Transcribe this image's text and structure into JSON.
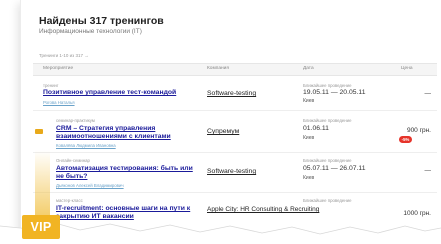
{
  "page": {
    "title": "Найдены 317 тренингов",
    "subtitle": "Информационные технологии (IT)",
    "pager": "Тренинги 1-10 из 317 →"
  },
  "table": {
    "columns": [
      "Мероприятие",
      "Компания",
      "Дата",
      "Цена"
    ],
    "rows": [
      {
        "type": "тренинг",
        "name": "Позитивное управление тест-командой",
        "author": "Рогова Наталья",
        "company": "Software-testing",
        "date_label": "Ближайшее проведение",
        "date": "19.05.11 — 20.05.11",
        "city": "Киев",
        "price": "—",
        "discount": "",
        "vip": false
      },
      {
        "type": "семинар-практикум",
        "name": "CRM – Стратегия управления взаимоотношениями с клиентами",
        "author": "Ковалёва Людмила Ивановна",
        "company": "Супремум",
        "date_label": "Ближайшее проведение",
        "date": "01.06.11",
        "city": "Киев",
        "price": "900 грн.",
        "discount": "-5%",
        "vip": true
      },
      {
        "type": "Онлайн-семинар",
        "name": "Автоматизация тестирования: быть или не быть?",
        "author": "Дьяконов Алексей Владимирович",
        "company": "Software-testing",
        "date_label": "Ближайшее проведение",
        "date": "05.07.11 — 26.07.11",
        "city": "Киев",
        "price": "—",
        "discount": "",
        "vip": false
      },
      {
        "type": "мастер-класс",
        "name": "IT-recruitment: основные шаги на пути к закрытию ИТ вакансии",
        "author": "",
        "company": "Apple City: HR Consulting & Recruiting",
        "date_label": "Ближайшее проведение",
        "date": "",
        "city": "",
        "price": "1000 грн.",
        "discount": "",
        "vip": false
      }
    ]
  },
  "vip_badge": "VIP",
  "colors": {
    "link": "#1a1a9a",
    "vip": "#f1b423",
    "discount": "#e6332a"
  }
}
